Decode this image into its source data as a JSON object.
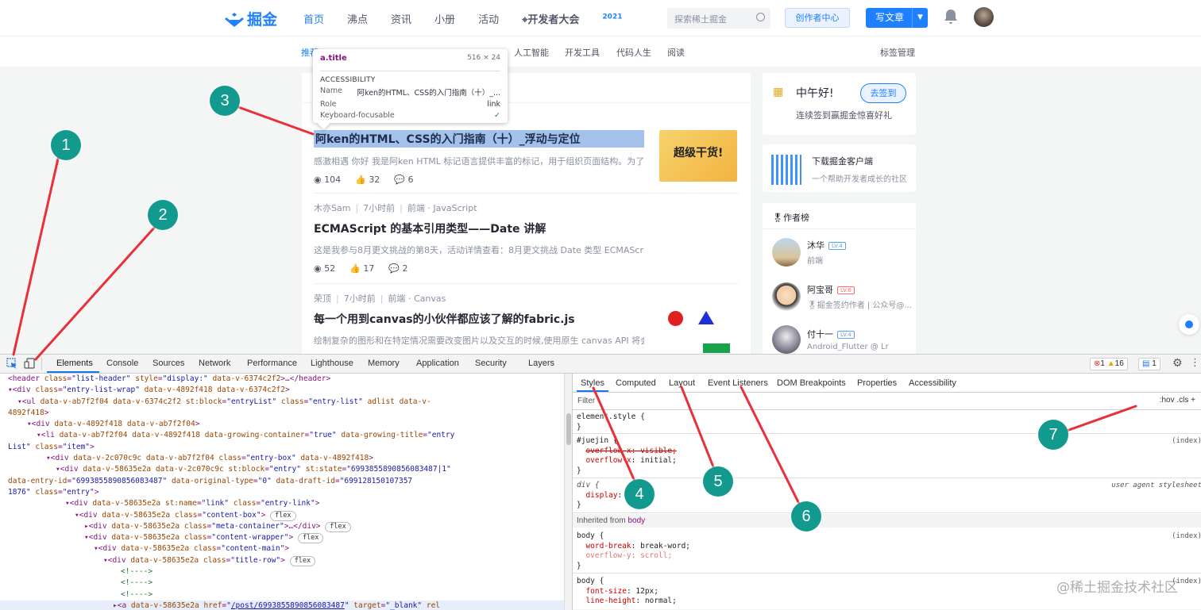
{
  "site": {
    "logo_text": "掘金",
    "nav": [
      "首页",
      "沸点",
      "资讯",
      "小册",
      "活动"
    ],
    "conference": "开发者大会",
    "conference_year": "2021",
    "search_placeholder": "探索稀土掘金",
    "creator_center": "创作者中心",
    "write_article": "写文章",
    "subnav_first": "推荐",
    "subnav": [
      "人工智能",
      "开发工具",
      "代码人生",
      "阅读"
    ],
    "tag_manage": "标签管理"
  },
  "tooltip": {
    "selector": "a.title",
    "size": "516 × 24",
    "section": "ACCESSIBILITY",
    "name_label": "Name",
    "name_value": "阿ken的HTML、CSS的入门指南（十）_...",
    "role_label": "Role",
    "role_value": "link",
    "focus_label": "Keyboard-focusable"
  },
  "entries": [
    {
      "title": "阿ken的HTML、CSS的入门指南（十）_浮动与定位",
      "abstract": "感激相遇 你好 我是阿ken HTML 标记语言提供丰富的标记，用于组织页面结构。为了使...",
      "views": "104",
      "likes": "32",
      "comments": "6",
      "thumb_text": "超级干货!"
    },
    {
      "author": "木亦Sam",
      "time": "7小时前",
      "category": "前端",
      "tag": "JavaScript",
      "title": "ECMAScript 的基本引用类型——Date 讲解",
      "abstract": "这是我参与8月更文挑战的第8天，活动详情查看：8月更文挑战 Date 类型 ECMAScript 的 Date 类型是参考 Jav...",
      "views": "52",
      "likes": "17",
      "comments": "2"
    },
    {
      "author": "荣顶",
      "time": "7小时前",
      "category": "前端",
      "tag": "Canvas",
      "title": "每一个用到canvas的小伙伴都应该了解的fabric.js",
      "abstract": "绘制复杂的图形和在特定情况需要改变图片以及交互的时候,使用原生 canvas API 将会..."
    }
  ],
  "sidebar": {
    "greeting": "中午好!",
    "sign_in": "去签到",
    "sign_tip": "连续签到赢掘金惊喜好礼",
    "download_title": "下载掘金客户端",
    "download_desc": "一个帮助开发者成长的社区",
    "authors_title": "🎖作者榜",
    "authors": [
      {
        "name": "沐华",
        "level": "LV.4",
        "desc": "前端",
        "color": "#5fa0e8"
      },
      {
        "name": "阿宝哥",
        "level": "LV.6",
        "desc": "🎖掘金签约作者 | 公众号@...",
        "color": "#ff6b6b"
      },
      {
        "name": "付十一",
        "level": "LV.4",
        "desc": "Android_Flutter @ Lr",
        "color": "#5fa0e8"
      }
    ]
  },
  "devtools": {
    "tabs": [
      "Elements",
      "Console",
      "Sources",
      "Network",
      "Performance",
      "Lighthouse",
      "Memory",
      "Application",
      "Security",
      "Layers"
    ],
    "errors": "1",
    "warnings": "16",
    "messages": "1",
    "dom_lines": [
      {
        "indent": 10,
        "html": "<span class='tag'>&lt;header</span> <span class='at'>class</span>=<span class='av2'>\"list-header\"</span> <span class='at'>style</span>=<span class='av2'>\"display:\"</span> <span class='at'>data-v-6374c2f2</span><span class='tag'>&gt;…&lt;/header&gt;</span>"
      },
      {
        "indent": 10,
        "html": "▾<span class='tag'>&lt;div</span> <span class='at'>class</span>=<span class='av2'>\"entry-list-wrap\"</span> <span class='at'>data-v-4892f418</span> <span class='at'>data-v-6374c2f2</span><span class='tag'>&gt;</span>"
      },
      {
        "indent": 22,
        "html": "▾<span class='tag'>&lt;ul</span> <span class='at'>data-v-ab7f2f04</span> <span class='at'>data-v-6374c2f2</span> <span class='at'>st:block</span>=<span class='av2'>\"entryList\"</span> <span class='at'>class</span>=<span class='av2'>\"entry-list\"</span> <span class='at'>adlist</span> <span class='at'>data-v-</span>"
      },
      {
        "indent": 10,
        "html": "<span class='at'>4892f418</span><span class='tag'>&gt;</span>"
      },
      {
        "indent": 34,
        "html": "▾<span class='tag'>&lt;div</span> <span class='at'>data-v-4892f418</span> <span class='at'>data-v-ab7f2f04</span><span class='tag'>&gt;</span>"
      },
      {
        "indent": 46,
        "html": "▾<span class='tag'>&lt;li</span> <span class='at'>data-v-ab7f2f04</span> <span class='at'>data-v-4892f418</span> <span class='at'>data-growing-container</span>=<span class='av2'>\"true\"</span> <span class='at'>data-growing-title</span>=<span class='av2'>\"entry</span>"
      },
      {
        "indent": 10,
        "html": "<span class='av2'>List\"</span> <span class='at'>class</span>=<span class='av2'>\"item\"</span><span class='tag'>&gt;</span>"
      },
      {
        "indent": 58,
        "html": "▾<span class='tag'>&lt;div</span> <span class='at'>data-v-2c070c9c</span> <span class='at'>data-v-ab7f2f04</span> <span class='at'>class</span>=<span class='av2'>\"entry-box\"</span> <span class='at'>data-v-4892f418</span><span class='tag'>&gt;</span>"
      },
      {
        "indent": 70,
        "html": "▾<span class='tag'>&lt;div</span> <span class='at'>data-v-58635e2a</span> <span class='at'>data-v-2c070c9c</span> <span class='at'>st:block</span>=<span class='av2'>\"entry\"</span> <span class='at'>st:state</span>=<span class='av2'>\"6993855890856083487|1\"</span>"
      },
      {
        "indent": 10,
        "html": "<span class='at'>data-entry-id</span>=<span class='av2'>\"6993855890856083487\"</span> <span class='at'>data-original-type</span>=<span class='av2'>\"0\"</span> <span class='at'>data-draft-id</span>=<span class='av2'>\"699128150107357</span>"
      },
      {
        "indent": 10,
        "html": "<span class='av2'>1876\"</span> <span class='at'>class</span>=<span class='av2'>\"entry\"</span><span class='tag'>&gt;</span>"
      },
      {
        "indent": 82,
        "html": "▾<span class='tag'>&lt;div</span> <span class='at'>data-v-58635e2a</span> <span class='at'>st:name</span>=<span class='av2'>\"link\"</span> <span class='at'>class</span>=<span class='av2'>\"entry-link\"</span><span class='tag'>&gt;</span>"
      },
      {
        "indent": 94,
        "html": "▾<span class='tag'>&lt;div</span> <span class='at'>data-v-58635e2a</span> <span class='at'>class</span>=<span class='av2'>\"content-box\"</span><span class='tag'>&gt;</span> <span class='pill'>flex</span>"
      },
      {
        "indent": 106,
        "html": "▸<span class='tag'>&lt;div</span> <span class='at'>data-v-58635e2a</span> <span class='at'>class</span>=<span class='av2'>\"meta-container\"</span><span class='tag'>&gt;…&lt;/div&gt;</span> <span class='pill'>flex</span>"
      },
      {
        "indent": 106,
        "html": "▾<span class='tag'>&lt;div</span> <span class='at'>data-v-58635e2a</span> <span class='at'>class</span>=<span class='av2'>\"content-wrapper\"</span><span class='tag'>&gt;</span> <span class='pill'>flex</span>"
      },
      {
        "indent": 118,
        "html": "▾<span class='tag'>&lt;div</span> <span class='at'>data-v-58635e2a</span> <span class='at'>class</span>=<span class='av2'>\"content-main\"</span><span class='tag'>&gt;</span>"
      },
      {
        "indent": 130,
        "html": "▾<span class='tag'>&lt;div</span> <span class='at'>data-v-58635e2a</span> <span class='at'>class</span>=<span class='av2'>\"title-row\"</span><span class='tag'>&gt;</span> <span class='pill'>flex</span>"
      },
      {
        "indent": 152,
        "html": "<span class='cm'>&lt;!----&gt;</span>"
      },
      {
        "indent": 152,
        "html": "<span class='cm'>&lt;!----&gt;</span>"
      },
      {
        "indent": 152,
        "html": "<span class='cm'>&lt;!----&gt;</span>"
      },
      {
        "indent": 142,
        "html": "▸<span class='tag'>&lt;a</span> <span class='at'>data-v-58635e2a</span> <span class='at'>href</span>=<span class='av2'>\"<u>/post/6993855890856083487</u>\"</span> <span class='at'>target</span>=<span class='av2'>\"_blank\"</span> <span class='at'>rel</span>",
        "selected": true
      }
    ],
    "style_tabs": [
      "Styles",
      "Computed",
      "Layout",
      "Event Listeners",
      "DOM Breakpoints",
      "Properties",
      "Accessibility"
    ],
    "filter_placeholder": "Filter",
    "filter_right": ":hov  .cls  +",
    "inherited_label": "Inherited from",
    "inherited_from": "body"
  },
  "callouts": [
    "1",
    "2",
    "3",
    "4",
    "5",
    "6",
    "7"
  ],
  "watermark": "@稀土掘金技术社区"
}
